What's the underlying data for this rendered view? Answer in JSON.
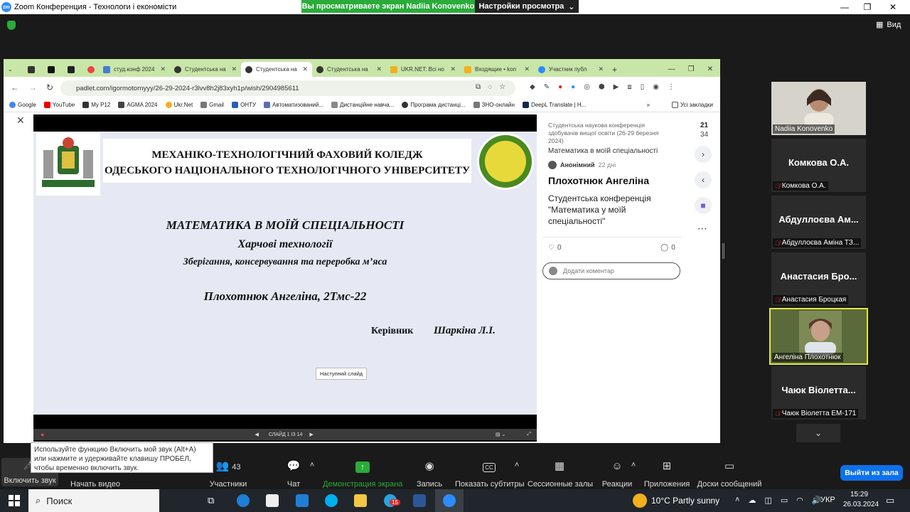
{
  "zoom": {
    "title": "Zoom Конференция - Технологи і економісти",
    "viewing_banner": "Вы просматриваете экран Nadiia Konovenko",
    "view_settings": "Настройки просмотра",
    "view_button": "Вид"
  },
  "browser": {
    "tabs": [
      {
        "label": "студ.конф 2024"
      },
      {
        "label": "Студентська на"
      },
      {
        "label": "Студентська на"
      },
      {
        "label": "Студентська на"
      },
      {
        "label": "UKR.NET: Всі но"
      },
      {
        "label": "Входящие • kon"
      },
      {
        "label": "Участник публ"
      }
    ],
    "url": "padlet.com/igormotornyyy/26-29-2024-r3lvv8h2j83xyh1p/wish/2904985611",
    "bookmarks": [
      "Google",
      "YouTube",
      "My P12",
      "AGMA 2024",
      "Ukr.Net",
      "Gmail",
      "ОНТУ",
      "Автоматизований...",
      "Дистанційне навча...",
      "Програма дистанці...",
      "ЗНО-онлайн",
      "DeepL Translate | H..."
    ],
    "all_bookmarks": "Усі закладки"
  },
  "slide": {
    "header_line1": "МЕХАНІКО-ТЕХНОЛОГІЧНИЙ ФАХОВИЙ КОЛЕДЖ",
    "header_line2": "ОДЕСЬКОГО НАЦІОНАЛЬНОГО ТЕХНОЛОГІЧНОГО УНІВЕРСИТЕТУ",
    "title": "МАТЕМАТИКА  В  МОЇЙ  СПЕЦІАЛЬНОСТІ",
    "subtitle": "Харчові технології",
    "subtitle2": "Зберігання, консервування та переробка м’яса",
    "author": "Плохотнюк Ангеліна,  2Тмс-22",
    "supervisor_label": "Керівник",
    "supervisor": "Шаркіна Л.І.",
    "counter": "СЛАЙД 1 ІЗ 14",
    "next_tooltip": "Наступний слайд"
  },
  "padlet": {
    "board_title": "Студентська наукова конференція здобувачів вищої освіти (26-29 березня 2024)",
    "section": "Математика в моїй спеціальності",
    "author": "Анонімний",
    "time": "22 дні",
    "post_title": "Плохотнюк Ангеліна",
    "post_body": "Студентська конференція \"Математика у моїй спеціальності\"",
    "likes": "0",
    "comments": "0",
    "comment_placeholder": "Додати коментар",
    "count_top": "21",
    "count_bottom": "34"
  },
  "participants": [
    {
      "label": "Nadiia Konovenko",
      "big": ""
    },
    {
      "label": "Комкова О.А.",
      "big": "Комкова О.А."
    },
    {
      "label": "Абдуллоєва Аміна ТЗ...",
      "big": "Абдуллоєва Ам..."
    },
    {
      "label": "Анастасия Броцкая",
      "big": "Анастасия Бро..."
    },
    {
      "label": "Ангеліна Плохотнюк",
      "big": ""
    },
    {
      "label": "Чаюк Віолетта ЕМ-171",
      "big": "Чаюк Віолетта..."
    }
  ],
  "toolbar": {
    "unmute": "Включить звук",
    "video": "Начать видео",
    "participants": "Участники",
    "participants_count": "43",
    "chat": "Чат",
    "share": "Демонстрация экрана",
    "record": "Запись",
    "captions": "Показать субтитры",
    "breakout": "Сессионные залы",
    "reactions": "Реакции",
    "apps": "Приложения",
    "whiteboards": "Доски сообщений",
    "leave": "Выйти из зала",
    "unmute_tip": "Используйте функцию Включить мой звук (Alt+A) или нажмите и удерживайте клавишу ПРОБЕЛ, чтобы временно включить звук."
  },
  "taskbar": {
    "search": "Поиск",
    "weather": "10°C  Partly sunny",
    "lang": "УКР",
    "time": "15:29",
    "date": "26.03.2024",
    "badge": "15"
  }
}
